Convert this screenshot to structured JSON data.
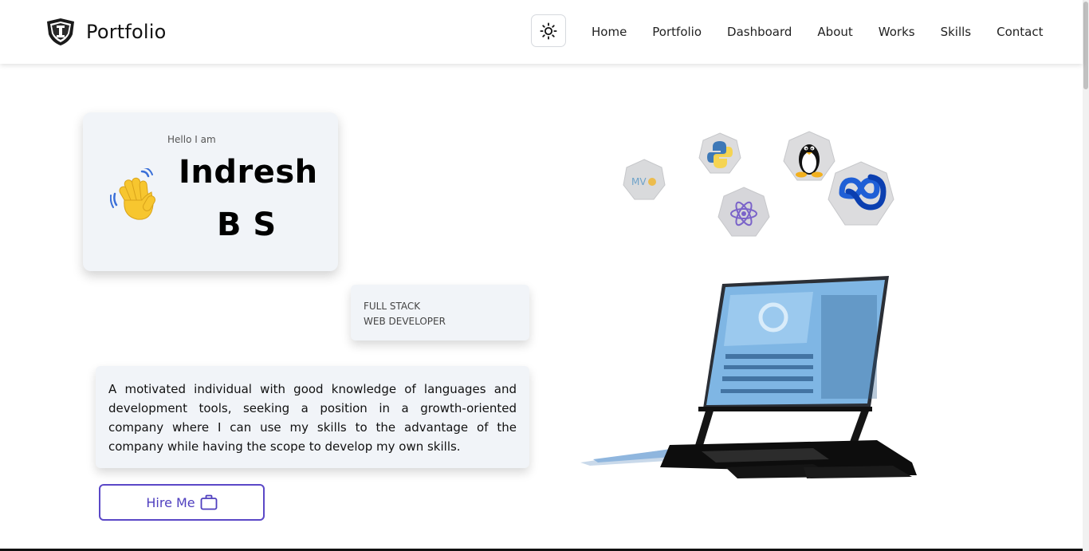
{
  "header": {
    "brand": "Portfolio",
    "nav": [
      "Home",
      "Portfolio",
      "Dashboard",
      "About",
      "Works",
      "Skills",
      "Contact"
    ]
  },
  "hero": {
    "greeting": "Hello I am",
    "name_line1": "Indresh",
    "name_line2": "B S",
    "role_line1": "FULL STACK",
    "role_line2": "WEB DEVELOPER",
    "about": "A motivated individual with good knowledge of languages and development tools, seeking a position in a growth-oriented company where I can use my skills to the advantage of the company while having the scope to develop my own skills.",
    "hire_label": "Hire Me"
  },
  "tech_icons": [
    "mvc-icon",
    "python-icon",
    "linux-icon",
    "react-icon",
    "visual-studio-icon"
  ],
  "colors": {
    "accent": "#5b48c7",
    "card": "#f1f4f8"
  }
}
